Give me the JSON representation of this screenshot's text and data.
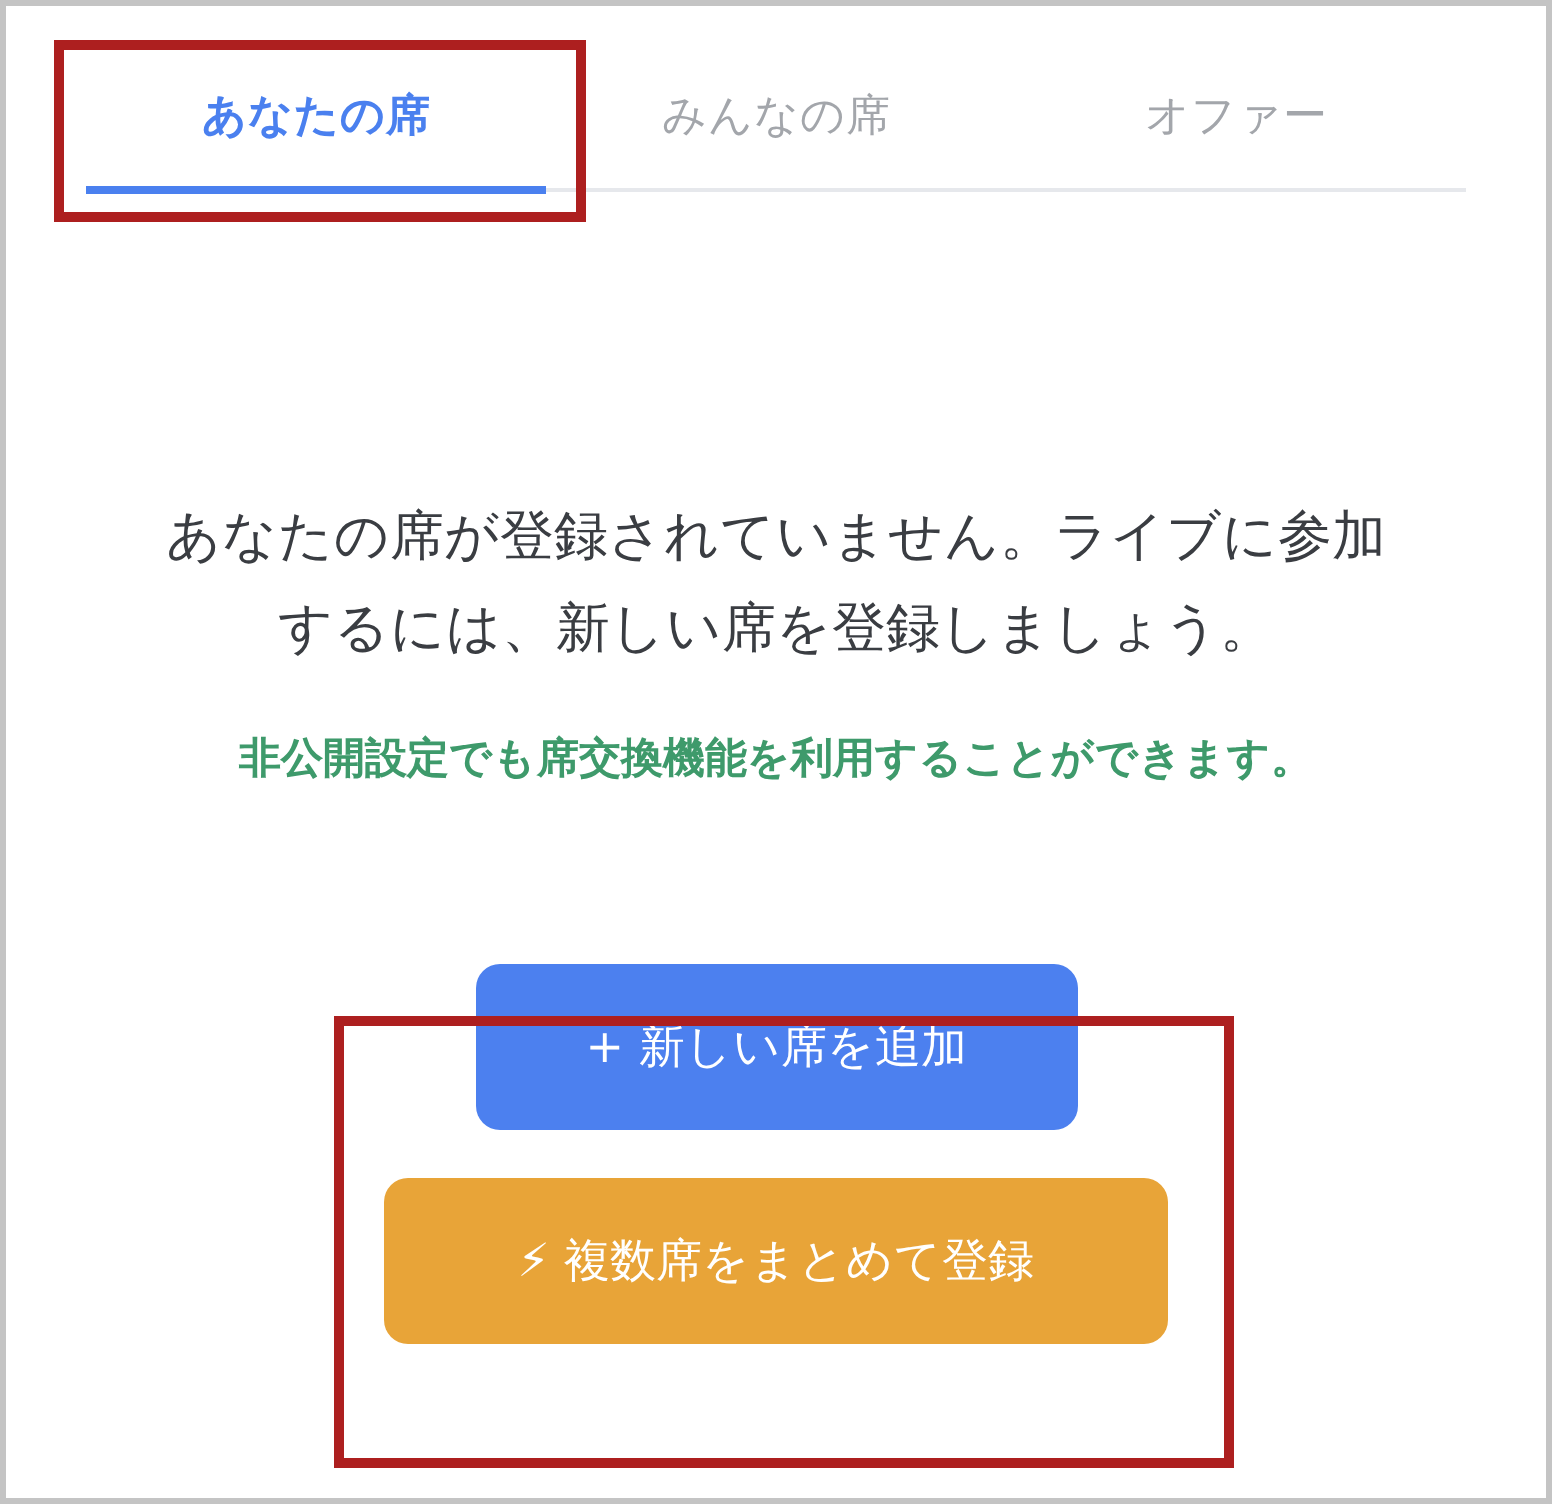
{
  "tabs": [
    {
      "label": "あなたの席",
      "selected": true
    },
    {
      "label": "みんなの席",
      "selected": false
    },
    {
      "label": "オファー",
      "selected": false
    }
  ],
  "message": "あなたの席が登録されていません。ライブに参加するには、新しい席を登録しましょう。",
  "note": "非公開設定でも席交換機能を利用することができます。",
  "buttons": [
    {
      "label": "+ 新しい席を追加",
      "kind": "primary"
    },
    {
      "label": "⚡ 複数席をまとめて登録",
      "kind": "bulk"
    }
  ]
}
